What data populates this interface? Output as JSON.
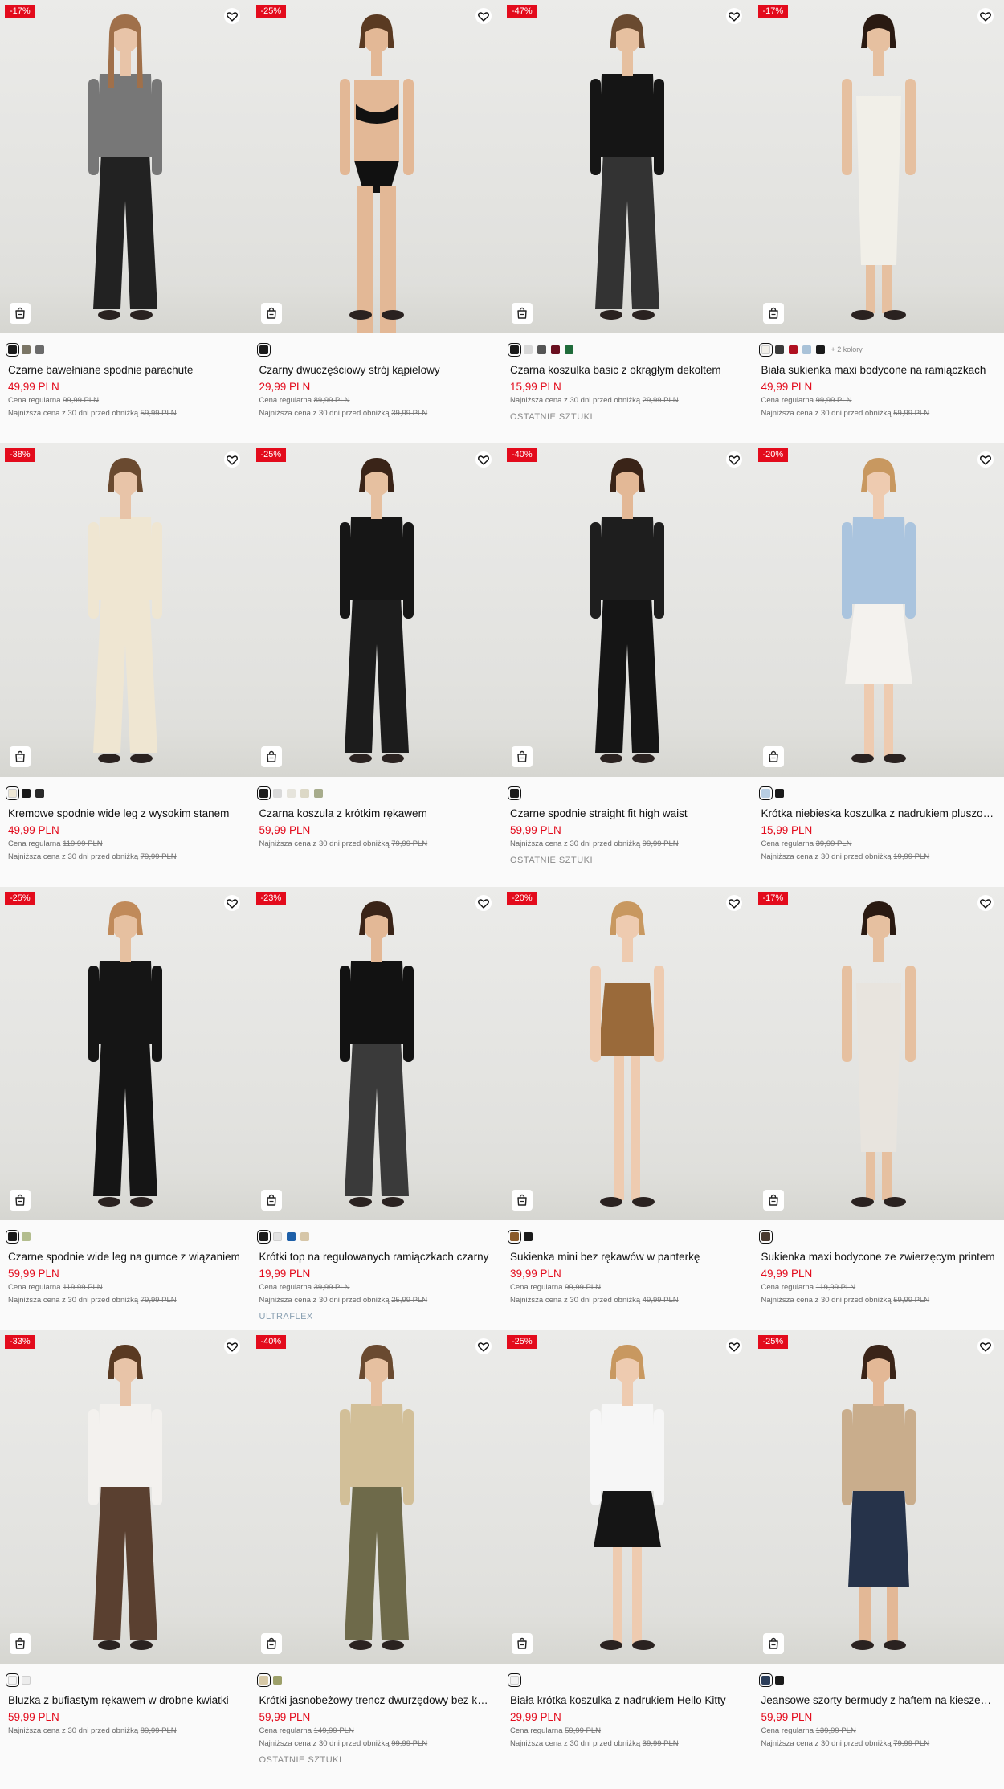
{
  "colors": {
    "accent": "#e30b1c",
    "text": "#111111",
    "muted": "#666666"
  },
  "labels": {
    "regular": "Cena regularna",
    "lowest": "Najniższa cena z 30 dni przed obniżką"
  },
  "products": [
    {
      "badge": "-17%",
      "name": "Czarne bawełniane spodnie parachute",
      "price": "49,99 PLN",
      "regular": "99,99 PLN",
      "lowest": "59,99 PLN",
      "tag": "",
      "more": "",
      "swatches": [
        "#1a1a1a",
        "#7a7565",
        "#6b6b6b"
      ]
    },
    {
      "badge": "-25%",
      "name": "Czarny dwuczęściowy strój kąpielowy",
      "price": "29,99 PLN",
      "regular": "89,99 PLN",
      "lowest": "39,99 PLN",
      "tag": "",
      "more": "",
      "swatches": [
        "#1a1a1a"
      ]
    },
    {
      "badge": "-47%",
      "name": "Czarna koszulka basic z okrągłym dekoltem",
      "price": "15,99 PLN",
      "regular": "",
      "lowest": "29,99 PLN",
      "tag": "OSTATNIE SZTUKI",
      "more": "",
      "swatches": [
        "#1a1a1a",
        "#d8d8d8",
        "#555555",
        "#6a1020",
        "#1f6b3a"
      ]
    },
    {
      "badge": "-17%",
      "name": "Biała sukienka maxi bodycone na ramiączkach",
      "price": "49,99 PLN",
      "regular": "99,99 PLN",
      "lowest": "59,99 PLN",
      "tag": "",
      "more": "+ 2 kolory",
      "swatches": [
        "#f2f0ea",
        "#3a3a3a",
        "#b01020",
        "#a9c2d8",
        "#1a1a1a"
      ]
    },
    {
      "badge": "-38%",
      "name": "Kremowe spodnie wide leg z wysokim stanem",
      "price": "49,99 PLN",
      "regular": "119,99 PLN",
      "lowest": "79,99 PLN",
      "tag": "",
      "more": "",
      "swatches": [
        "#efe8d6",
        "#1a1a1a",
        "#2a2a2a"
      ]
    },
    {
      "badge": "-25%",
      "name": "Czarna koszula z krótkim rękawem",
      "price": "59,99 PLN",
      "regular": "",
      "lowest": "79,99 PLN",
      "tag": "",
      "more": "",
      "swatches": [
        "#1a1a1a",
        "#d9d9d9",
        "#e6e4dc",
        "#dcd8c6",
        "#a7ac8c"
      ]
    },
    {
      "badge": "-40%",
      "name": "Czarne spodnie straight fit high waist",
      "price": "59,99 PLN",
      "regular": "",
      "lowest": "99,99 PLN",
      "tag": "OSTATNIE SZTUKI",
      "more": "",
      "swatches": [
        "#1a1a1a"
      ]
    },
    {
      "badge": "-20%",
      "name": "Krótka niebieska koszulka z nadrukiem pluszowego misia",
      "price": "15,99 PLN",
      "regular": "39,99 PLN",
      "lowest": "19,99 PLN",
      "tag": "",
      "more": "",
      "swatches": [
        "#b7cde2",
        "#1a1a1a"
      ]
    },
    {
      "badge": "-25%",
      "name": "Czarne spodnie wide leg na gumce z wiązaniem",
      "price": "59,99 PLN",
      "regular": "119,99 PLN",
      "lowest": "79,99 PLN",
      "tag": "",
      "more": "",
      "swatches": [
        "#1a1a1a",
        "#b3bd8e"
      ]
    },
    {
      "badge": "-23%",
      "name": "Krótki top na regulowanych ramiączkach czarny",
      "price": "19,99 PLN",
      "regular": "39,99 PLN",
      "lowest": "25,99 PLN",
      "tag": "ULTRAFLEX",
      "more": "",
      "swatches": [
        "#1a1a1a",
        "#e2e2e2",
        "#1d5fa8",
        "#d6c6a8"
      ]
    },
    {
      "badge": "-20%",
      "name": "Sukienka mini bez rękawów w panterkę",
      "price": "39,99 PLN",
      "regular": "99,99 PLN",
      "lowest": "49,99 PLN",
      "tag": "",
      "more": "",
      "swatches": [
        "#8a5a2a",
        "#1a1a1a"
      ]
    },
    {
      "badge": "-17%",
      "name": "Sukienka maxi bodycone ze zwierzęcym printem",
      "price": "49,99 PLN",
      "regular": "119,99 PLN",
      "lowest": "59,99 PLN",
      "tag": "",
      "more": "",
      "swatches": [
        "#4a3a30"
      ]
    },
    {
      "badge": "-33%",
      "name": "Bluzka z bufiastym rękawem w drobne kwiatki",
      "price": "59,99 PLN",
      "regular": "",
      "lowest": "89,99 PLN",
      "tag": "",
      "more": "",
      "swatches": [
        "#f4f4f4",
        "#ececec"
      ]
    },
    {
      "badge": "-40%",
      "name": "Krótki jasnobeżowy trencz dwurzędowy bez kaptura",
      "price": "59,99 PLN",
      "regular": "149,99 PLN",
      "lowest": "99,99 PLN",
      "tag": "OSTATNIE SZTUKI",
      "more": "",
      "swatches": [
        "#d6c8a6",
        "#9da06a"
      ]
    },
    {
      "badge": "-25%",
      "name": "Biała krótka koszulka z nadrukiem Hello Kitty",
      "price": "29,99 PLN",
      "regular": "59,99 PLN",
      "lowest": "39,99 PLN",
      "tag": "",
      "more": "",
      "swatches": [
        "#f2f2f2"
      ]
    },
    {
      "badge": "-25%",
      "name": "Jeansowe szorty bermudy z haftem na kieszeniach",
      "price": "59,99 PLN",
      "regular": "139,99 PLN",
      "lowest": "79,99 PLN",
      "tag": "",
      "more": "",
      "swatches": [
        "#2c3e5a",
        "#1a1a1a"
      ]
    }
  ]
}
